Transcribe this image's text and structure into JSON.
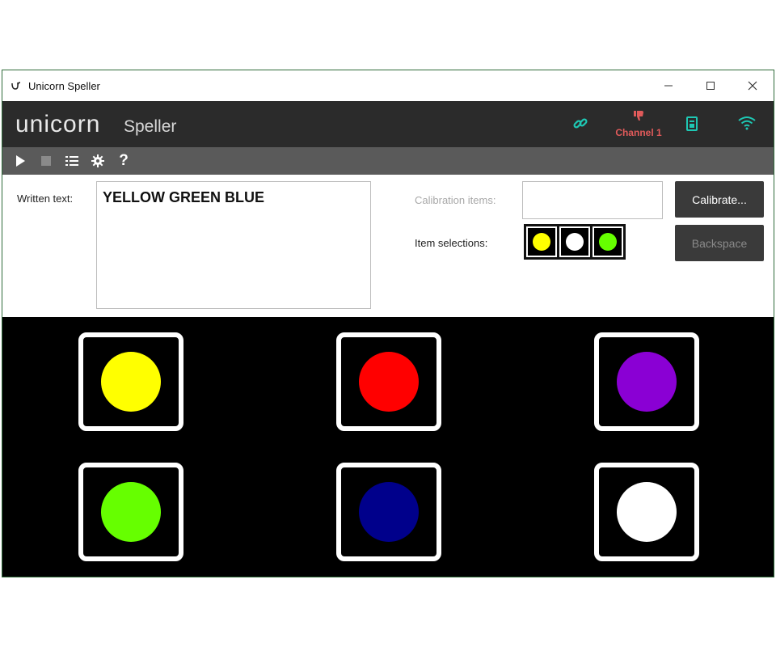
{
  "window": {
    "title": "Unicorn Speller"
  },
  "brand": {
    "logo_text": "unicorn",
    "subtitle": "Speller"
  },
  "status": {
    "link_icon": "link-icon",
    "channel_label": "Channel 1",
    "channel_icon": "thumbs-down-icon",
    "battery_icon": "battery-icon",
    "wifi_icon": "wifi-icon"
  },
  "toolbar": {
    "items": [
      "play-icon",
      "stop-icon",
      "list-icon",
      "gear-icon",
      "help-icon"
    ],
    "help_label": "?"
  },
  "panel": {
    "written_label": "Written text:",
    "written_value": "YELLOW GREEN BLUE",
    "calibration_label": "Calibration items:",
    "calibration_value": "",
    "selections_label": "Item selections:",
    "selections": [
      "#ffff00",
      "#ffffff",
      "#66ff00"
    ],
    "calibrate_button": "Calibrate...",
    "backspace_button": "Backspace"
  },
  "grid": {
    "items": [
      {
        "name": "yellow",
        "color": "#ffff00"
      },
      {
        "name": "red",
        "color": "#ff0000"
      },
      {
        "name": "purple",
        "color": "#8a00d4"
      },
      {
        "name": "green",
        "color": "#66ff00"
      },
      {
        "name": "blue",
        "color": "#00008b"
      },
      {
        "name": "white",
        "color": "#ffffff"
      }
    ]
  },
  "colors": {
    "accent": "#1ec8b4",
    "channel": "#e05a5a",
    "brandbar": "#2b2b2b",
    "toolbar": "#5a5a5a"
  }
}
